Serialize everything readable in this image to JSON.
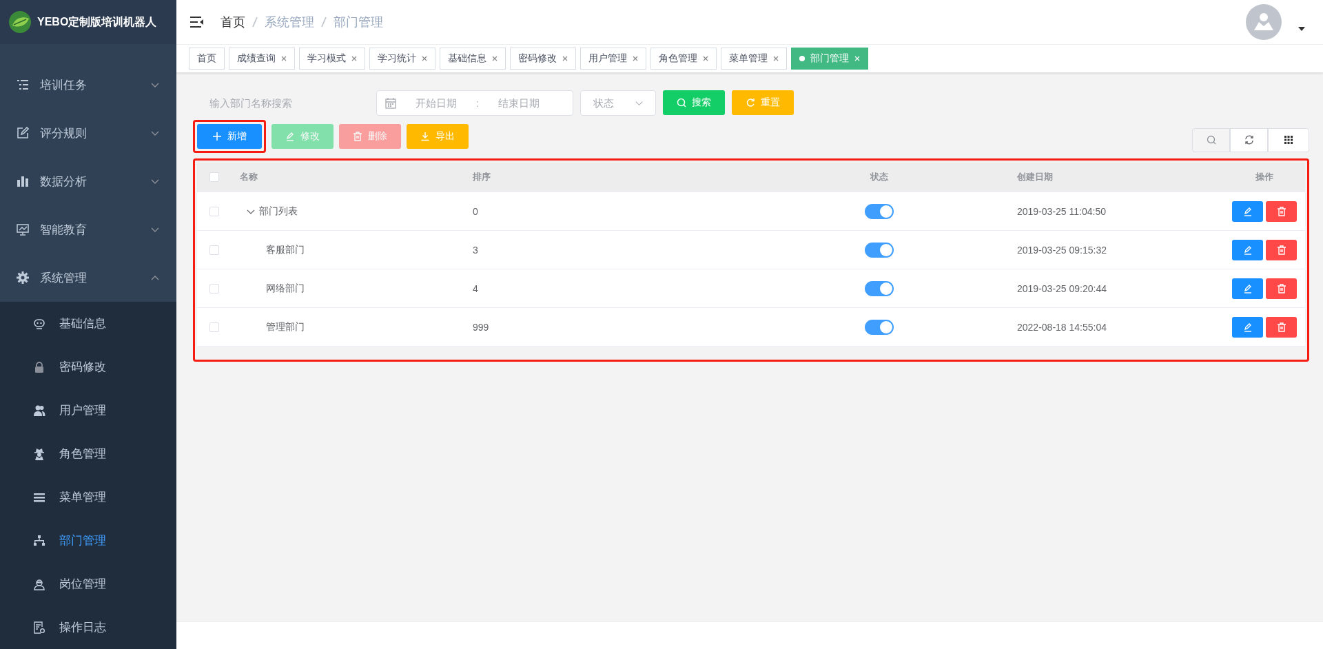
{
  "sidebar": {
    "logo_text": "YEBO定制版培训机器人",
    "items": [
      {
        "label": "培训任务",
        "expanded": false
      },
      {
        "label": "评分规则",
        "expanded": false
      },
      {
        "label": "数据分析",
        "expanded": false
      },
      {
        "label": "智能教育",
        "expanded": false
      },
      {
        "label": "系统管理",
        "expanded": true,
        "children": [
          {
            "label": "基础信息",
            "selected": false
          },
          {
            "label": "密码修改",
            "selected": false
          },
          {
            "label": "用户管理",
            "selected": false
          },
          {
            "label": "角色管理",
            "selected": false
          },
          {
            "label": "菜单管理",
            "selected": false
          },
          {
            "label": "部门管理",
            "selected": true
          },
          {
            "label": "岗位管理",
            "selected": false
          },
          {
            "label": "操作日志",
            "selected": false
          }
        ]
      }
    ]
  },
  "breadcrumb": [
    "首页",
    "系统管理",
    "部门管理"
  ],
  "tags": [
    {
      "label": "首页",
      "closable": false,
      "selected": false
    },
    {
      "label": "成绩查询",
      "closable": true,
      "selected": false
    },
    {
      "label": "学习模式",
      "closable": true,
      "selected": false
    },
    {
      "label": "学习统计",
      "closable": true,
      "selected": false
    },
    {
      "label": "基础信息",
      "closable": true,
      "selected": false
    },
    {
      "label": "密码修改",
      "closable": true,
      "selected": false
    },
    {
      "label": "用户管理",
      "closable": true,
      "selected": false
    },
    {
      "label": "角色管理",
      "closable": true,
      "selected": false
    },
    {
      "label": "菜单管理",
      "closable": true,
      "selected": false
    },
    {
      "label": "部门管理",
      "closable": true,
      "selected": true
    }
  ],
  "filters": {
    "name": {
      "placeholder": "输入部门名称搜索"
    },
    "date_start": {
      "placeholder": "开始日期"
    },
    "date_separator": ":",
    "date_end": {
      "placeholder": "结束日期"
    },
    "status": {
      "placeholder": "状态"
    },
    "buttons": [
      {
        "kind": "search",
        "label": "搜索"
      },
      {
        "kind": "reset",
        "label": "重置"
      }
    ]
  },
  "actions": [
    {
      "kind": "add",
      "label": "新增",
      "disabled": false,
      "highlighted": true
    },
    {
      "kind": "edit",
      "label": "修改",
      "disabled": true,
      "highlighted": false
    },
    {
      "kind": "delete",
      "label": "删除",
      "disabled": true,
      "highlighted": false
    },
    {
      "kind": "export",
      "label": "导出",
      "disabled": false,
      "highlighted": false
    }
  ],
  "table": {
    "highlighted": true,
    "all_checked": false,
    "columns": [
      "名称",
      "排序",
      "状态",
      "创建日期",
      "操作"
    ],
    "rows": [
      {
        "name": "部门列表",
        "sort": "0",
        "on": true,
        "created": "2019-03-25 11:04:50",
        "checked": false,
        "expanded": true,
        "children": [
          {
            "name": "客服部门",
            "sort": "3",
            "on": true,
            "created": "2019-03-25 09:15:32",
            "checked": false
          },
          {
            "name": "网络部门",
            "sort": "4",
            "on": true,
            "created": "2019-03-25 09:20:44",
            "checked": false
          },
          {
            "name": "管理部门",
            "sort": "999",
            "on": true,
            "created": "2022-08-18 14:55:04",
            "checked": false
          }
        ]
      }
    ]
  }
}
